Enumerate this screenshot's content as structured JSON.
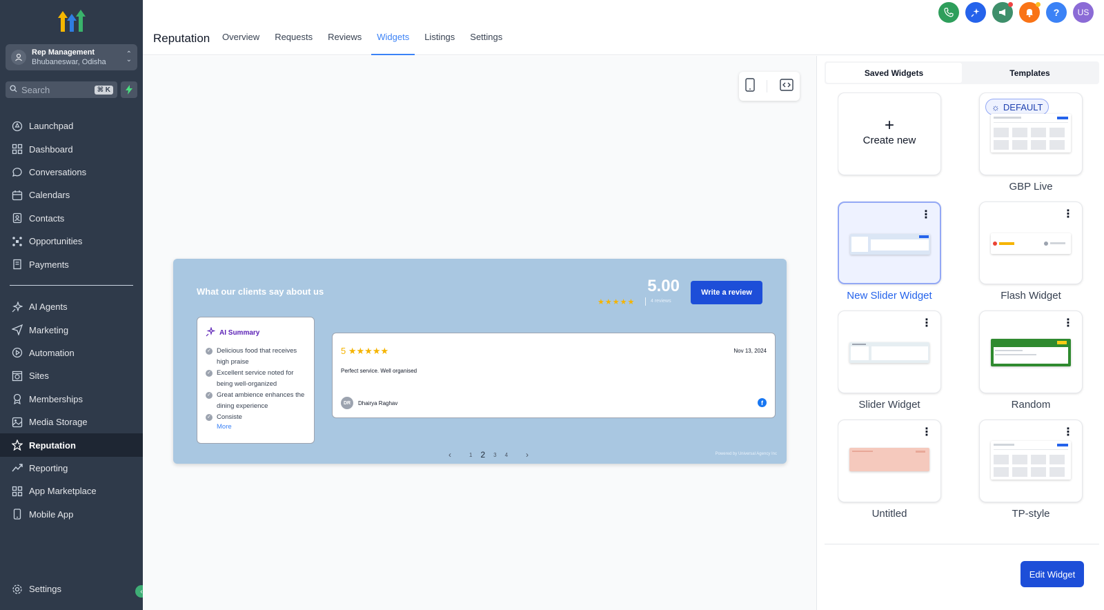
{
  "sidebar": {
    "account": {
      "name": "Rep Management",
      "location": "Bhubaneswar, Odisha"
    },
    "search": {
      "placeholder": "Search",
      "shortcut": "⌘ K"
    },
    "items": [
      {
        "label": "Launchpad",
        "icon": "rocket-icon"
      },
      {
        "label": "Dashboard",
        "icon": "dashboard-icon"
      },
      {
        "label": "Conversations",
        "icon": "chat-icon"
      },
      {
        "label": "Calendars",
        "icon": "calendar-icon"
      },
      {
        "label": "Contacts",
        "icon": "contacts-icon"
      },
      {
        "label": "Opportunities",
        "icon": "opportunities-icon"
      },
      {
        "label": "Payments",
        "icon": "payments-icon"
      }
    ],
    "items2": [
      {
        "label": "AI Agents",
        "icon": "ai-agents-icon"
      },
      {
        "label": "Marketing",
        "icon": "send-icon"
      },
      {
        "label": "Automation",
        "icon": "automation-icon"
      },
      {
        "label": "Sites",
        "icon": "sites-icon"
      },
      {
        "label": "Memberships",
        "icon": "memberships-icon"
      },
      {
        "label": "Media Storage",
        "icon": "media-icon"
      },
      {
        "label": "Reputation",
        "icon": "star-icon",
        "active": true
      },
      {
        "label": "Reporting",
        "icon": "reporting-icon"
      },
      {
        "label": "App Marketplace",
        "icon": "marketplace-icon"
      },
      {
        "label": "Mobile App",
        "icon": "mobile-icon"
      }
    ],
    "settings_label": "Settings"
  },
  "header": {
    "title": "Reputation",
    "tabs": [
      "Overview",
      "Requests",
      "Reviews",
      "Widgets",
      "Listings",
      "Settings"
    ],
    "active_tab": "Widgets",
    "avatar_initials": "US",
    "colors": {
      "phone": "#2e9e5b",
      "ai": "#2563eb",
      "announce": "#3e8f6b",
      "bell": "#f97316",
      "help": "#3b82f6",
      "avatar": "#8b6bd6"
    }
  },
  "widget_preview": {
    "title": "What our clients say about us",
    "score": "5.00",
    "stars": "★★★★★",
    "review_count": "4 reviews",
    "write_button": "Write a review",
    "ai_summary": {
      "title": "AI Summary",
      "items": [
        "Delicious food that receives high praise",
        "Excellent service noted for being well-organized",
        "Great ambience enhances the dining experience",
        "Consiste"
      ],
      "more": "More"
    },
    "review": {
      "rating": "5",
      "stars": "★★★★★",
      "date": "Nov 13, 2024",
      "text": "Perfect service. Well organised",
      "author_initials": "DR",
      "author": "Dhairya Raghav"
    },
    "pager": [
      "1",
      "2",
      "3",
      "4"
    ],
    "current_page": "2",
    "powered_by": "Powered by Universal Agency Inc"
  },
  "right_panel": {
    "tabs": [
      "Saved Widgets",
      "Templates"
    ],
    "active_tab": "Saved Widgets",
    "create_new": "Create new",
    "default_badge": "DEFAULT",
    "widgets": [
      "GBP Live",
      "New Slider Widget",
      "Flash Widget",
      "Slider Widget",
      "Random",
      "Untitled",
      "TP-style"
    ],
    "selected_widget": "New Slider Widget",
    "edit_button": "Edit Widget"
  }
}
